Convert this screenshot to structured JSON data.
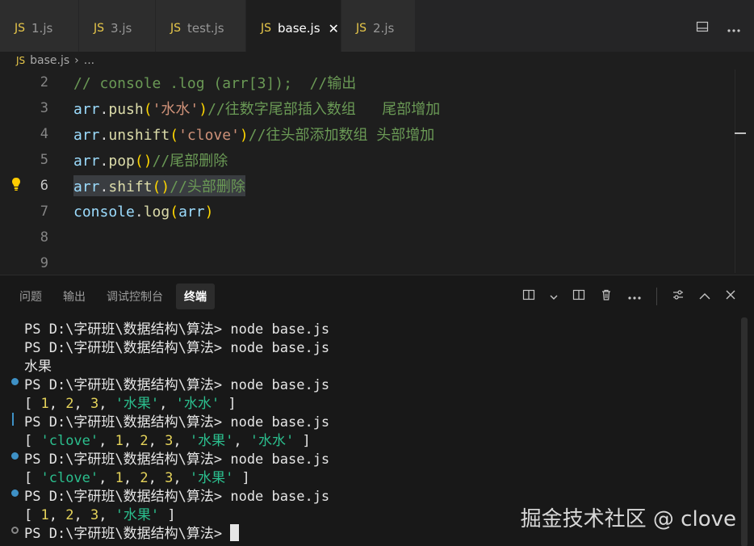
{
  "tabs": [
    {
      "icon": "JS",
      "label": "1.js"
    },
    {
      "icon": "JS",
      "label": "3.js"
    },
    {
      "icon": "JS",
      "label": "test.js"
    },
    {
      "icon": "JS",
      "label": "base.js",
      "active": true,
      "close": "✕"
    },
    {
      "icon": "JS",
      "label": "2.js"
    }
  ],
  "breadcrumb": {
    "icon": "JS",
    "file": "base.js",
    "sep": "›",
    "more": "..."
  },
  "editor": {
    "lines": [
      {
        "num": "2",
        "parts": [
          "// console .log (arr[3]);  //输出"
        ]
      },
      {
        "num": "3",
        "parts": [
          "arr",
          ".",
          "push",
          "(",
          "'水水'",
          ")",
          "//往数字尾部插入数组   尾部增加"
        ]
      },
      {
        "num": "4",
        "parts": [
          "arr",
          ".",
          "unshift",
          "(",
          "'clove'",
          ")",
          "//往头部添加数组 头部增加"
        ]
      },
      {
        "num": "5",
        "parts": [
          "arr",
          ".",
          "pop",
          "()",
          "//尾部删除"
        ]
      },
      {
        "num": "6",
        "parts": [
          "arr",
          ".",
          "shift",
          "()",
          "//头部删除"
        ]
      },
      {
        "num": "7",
        "parts": [
          "console",
          ".",
          "log",
          "(",
          "arr",
          ")"
        ]
      },
      {
        "num": "8",
        "parts": []
      },
      {
        "num": "9",
        "parts": []
      }
    ]
  },
  "panel": {
    "tabs": [
      "问题",
      "输出",
      "调试控制台",
      "终端"
    ],
    "active_tab": "终端"
  },
  "terminal": {
    "prompt": "PS D:\\字研班\\数据结构\\算法> ",
    "command": "node base.js",
    "lines": [
      "PS D:\\字研班\\数据结构\\算法> node base.js",
      "PS D:\\字研班\\数据结构\\算法> node base.js",
      "水果",
      "PS D:\\字研班\\数据结构\\算法> node base.js",
      "[ 1, 2, 3, '水果', '水水' ]",
      "PS D:\\字研班\\数据结构\\算法> node base.js",
      "[ 'clove', 1, 2, 3, '水果', '水水' ]",
      "PS D:\\字研班\\数据结构\\算法> node base.js",
      "[ 'clove', 1, 2, 3, '水果' ]",
      "PS D:\\字研班\\数据结构\\算法> node base.js",
      "[ 1, 2, 3, '水果' ]",
      "PS D:\\字研班\\数据结构\\算法> "
    ]
  },
  "watermark": "掘金技术社区 @ clove"
}
